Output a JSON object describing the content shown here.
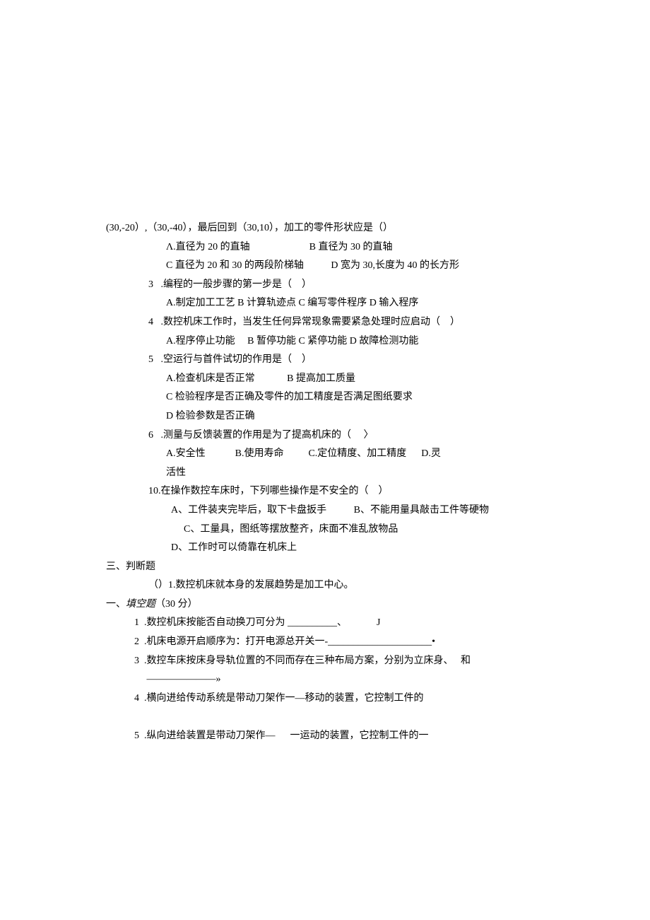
{
  "lines": [
    {
      "cls": "",
      "text": "(30,-20）,（30,-40），最后回到（30,10），加工的零件形状应是（）"
    },
    {
      "cls": "indent2",
      "text": "Λ.直径为 20 的直轴                        B 直径为 30 的直轴"
    },
    {
      "cls": "indent2",
      "text": "C 直径为 20 和 30 的两段阶梯轴           D 宽为 30,长度为 40 的长方形"
    },
    {
      "cls": "indent1",
      "text": "3   .编程的一般步骤的第一步是（    ）"
    },
    {
      "cls": "indent2",
      "text": "A.制定加工工艺 B 计算轨迹点 C 编写零件程序 D 输入程序"
    },
    {
      "cls": "indent1",
      "text": "4   .数控机床工作时，当发生任何异常现象需要紧急处理时应启动（    ）"
    },
    {
      "cls": "indent2",
      "text": "A.程序停止功能     B 暂停功能 C 紧停功能 D 故障检测功能"
    },
    {
      "cls": "indent1",
      "text": "5   .空运行与首件试切的作用是（    ）"
    },
    {
      "cls": "indent2",
      "text": "A.检查机床是否正常             B 提高加工质量"
    },
    {
      "cls": "indent2",
      "text": "C 检验程序是否正确及零件的加工精度是否满足图纸要求"
    },
    {
      "cls": "indent2",
      "text": "D 检验参数是否正确"
    },
    {
      "cls": "indent1",
      "text": "6   .测量与反馈装置的作用是为了提高机床的（     〉"
    },
    {
      "cls": "indent2",
      "text": "A.安全性            B.使用寿命          C.定位精度、加工精度      D.灵"
    },
    {
      "cls": "indent2",
      "text": "活性"
    },
    {
      "cls": "indent1",
      "text": "10.在操作数控车床时，下列哪些操作是不安全的（    ）"
    },
    {
      "cls": "indent2",
      "text": "  A、工件装夹完毕后，取下卡盘扳手           B、不能用量具敲击工件等硬物"
    },
    {
      "cls": "indent4",
      "text": "C、工量具，图纸等摆放整齐，床面不准乱放物品"
    },
    {
      "cls": "indent2",
      "text": "  D、工作时可以倚靠在机床上"
    },
    {
      "cls": "",
      "text": "三、判断题"
    },
    {
      "cls": "indent1",
      "text": "（）1.数控机床就本身的发展趋势是加工中心。"
    },
    {
      "cls": "",
      "text": "一、<span class=\"italic\">填空题</span>（30 分）"
    },
    {
      "cls": "indent3",
      "text": "1  .数控机床按能否自动换刀可分为 __________、            J"
    },
    {
      "cls": "indent3",
      "text": "2  .机床电源开启顺序为：打开电源总开关一-_____________________•"
    },
    {
      "cls": "indent3",
      "text": "3  .数控车床按床身导轨位置的不同而存在三种布局方案，分别为立床身、   和"
    },
    {
      "cls": "indent3",
      "text": "     ———————»"
    },
    {
      "cls": "indent3",
      "text": "4  .横向进给传动系统是带动刀架作一—移动的装置，它控制工件的"
    },
    {
      "cls": "",
      "text": " "
    },
    {
      "cls": "indent3",
      "text": "5  .纵向进给装置是带动刀架作—      一运动的装置，它控制工件的一"
    }
  ]
}
